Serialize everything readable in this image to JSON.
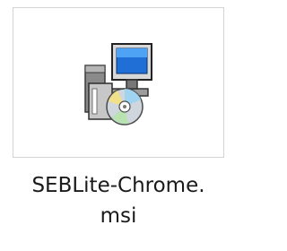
{
  "file": {
    "name_line1": "SEBLite-Chrome.",
    "name_line2": "msi",
    "icon": "msi-installer-icon"
  }
}
